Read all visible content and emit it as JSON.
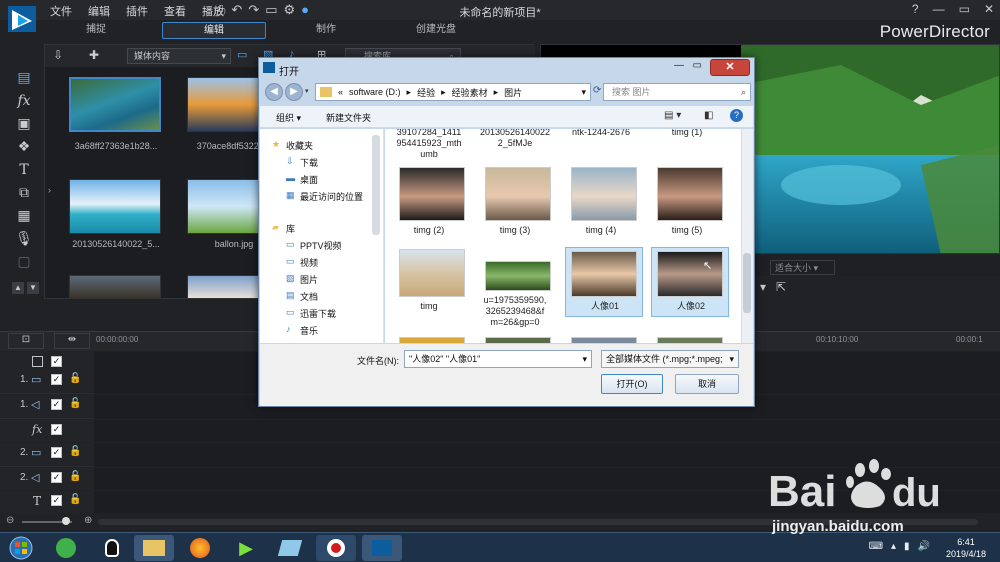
{
  "app": {
    "title": "未命名的新项目*",
    "brand": "PowerDirector",
    "menus": [
      "文件",
      "编辑",
      "插件",
      "查看",
      "播放"
    ],
    "mode_tabs": [
      "捕捉",
      "编辑",
      "制作",
      "创建光盘"
    ],
    "active_mode": "编辑"
  },
  "library": {
    "dropdown_value": "媒体内容",
    "search_placeholder": "搜索库",
    "items": [
      {
        "label": "3a68ff27363e1b28..."
      },
      {
        "label": "370ace8df53227..."
      },
      {
        "label": "20130526140022_5..."
      },
      {
        "label": "ballon.jpg"
      }
    ]
  },
  "preview": {
    "fit_label": "适合大小"
  },
  "timeline": {
    "ruler": [
      "00:00:00:00",
      "00:10:10:00",
      "00:00:1"
    ],
    "tracks": [
      {
        "num": "",
        "type": "master"
      },
      {
        "num": "1.",
        "type": "video"
      },
      {
        "num": "1.",
        "type": "audio"
      },
      {
        "num": "",
        "type": "fx"
      },
      {
        "num": "2.",
        "type": "video"
      },
      {
        "num": "2.",
        "type": "audio"
      },
      {
        "num": "",
        "type": "title"
      }
    ]
  },
  "dialog": {
    "title": "打开",
    "close_label": "✕",
    "address": [
      "software (D:)",
      "经验",
      "经验素材",
      "图片"
    ],
    "search_placeholder": "搜索 图片",
    "toolbar": {
      "organize": "组织 ▾",
      "new_folder": "新建文件夹"
    },
    "nav": {
      "favorites": "收藏夹",
      "downloads": "下载",
      "desktop": "桌面",
      "recent": "最近访问的位置",
      "libraries": "库",
      "pptv": "PPTV视频",
      "videos": "视频",
      "pictures": "图片",
      "docs": "文档",
      "xunlei": "迅雷下载",
      "music": "音乐"
    },
    "files_top": [
      "39107284_1411\n954415923_mth\numb",
      "20130526140022\n2_5fMJe",
      "ntk-1244-2676",
      "timg (1)"
    ],
    "files_row2": [
      "timg (2)",
      "timg (3)",
      "timg (4)",
      "timg (5)"
    ],
    "files_row3": [
      "timg",
      "u=1975359590,\n3265239468&f\nm=26&gp=0",
      "人像01",
      "人像02"
    ],
    "filename_label": "文件名(N):",
    "filename_value": "\"人像02\" \"人像01\"",
    "filetype_value": "全部媒体文件 (*.mpg;*.mpeg;",
    "open_label": "打开(O)",
    "cancel_label": "取消"
  },
  "taskbar": {
    "time": "6:41",
    "date": "2019/4/18"
  },
  "watermark": {
    "url": "jingyan.baidu.com"
  },
  "colors": {
    "accent": "#3f87c9",
    "dialog_frame": "#c7d7ea",
    "close_red": "#c7453a"
  }
}
